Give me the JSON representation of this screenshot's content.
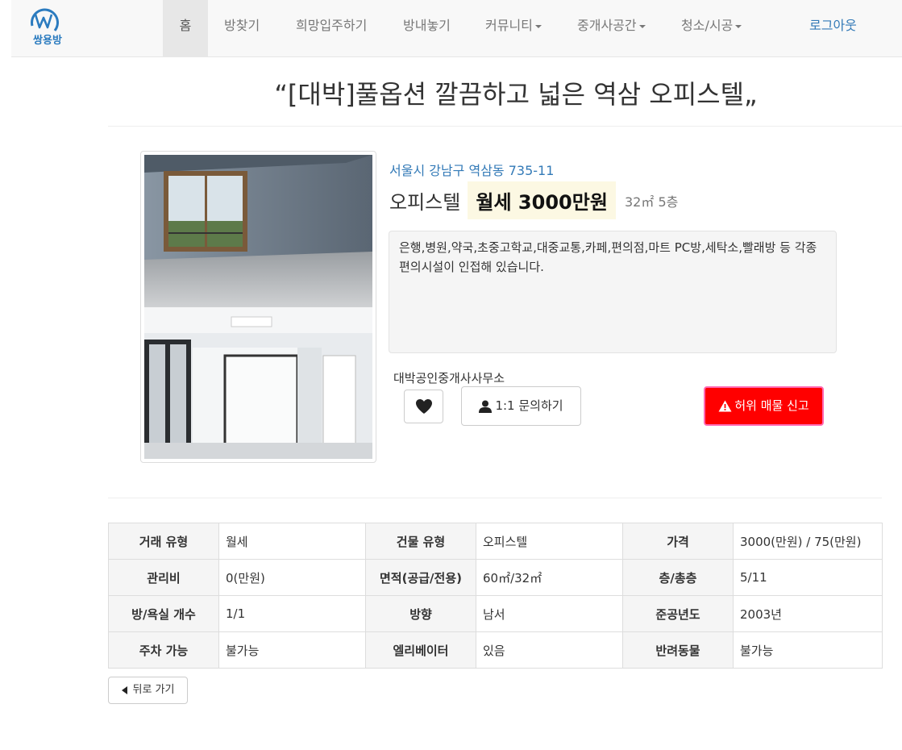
{
  "nav": {
    "logo_text": "쌍용방",
    "items": [
      {
        "label": "홈"
      },
      {
        "label": "방찾기"
      },
      {
        "label": "희망입주하기"
      },
      {
        "label": "방내놓기"
      },
      {
        "label": "커뮤니티"
      },
      {
        "label": "중개사공간"
      },
      {
        "label": "청소/시공"
      }
    ],
    "logout_label": "로그아웃"
  },
  "listing": {
    "title": "“[대박]풀옵션 깔끔하고 넓은 역삼 오피스텔„",
    "address": "서울시 강남구 역삼동 735-11",
    "building_type": "오피스텔",
    "price_label": "월세 3000만원",
    "size_floor": "32㎡ 5층",
    "description": "은행,병원,약국,초중고학교,대중교통,카페,편의점,마트 PC방,세탁소,빨래방 등 각종 편의시설이 인접해 있습니다.",
    "agency": "대박공인중개사사무소",
    "inquiry_label": "1:1 문의하기",
    "report_label": "허위 매물 신고",
    "heart_icon": "heart-icon",
    "user_icon": "user-icon",
    "warning_icon": "warning-icon"
  },
  "details": {
    "rows": [
      [
        {
          "label": "거래 유형",
          "value": "월세"
        },
        {
          "label": "건물 유형",
          "value": "오피스텔"
        },
        {
          "label": "가격",
          "value": "3000(만원) / 75(만원)"
        }
      ],
      [
        {
          "label": "관리비",
          "value": "0(만원)"
        },
        {
          "label": "면적(공급/전용)",
          "value": "60㎡/32㎡"
        },
        {
          "label": "층/총층",
          "value": "5/11"
        }
      ],
      [
        {
          "label": "방/욕실 개수",
          "value": "1/1"
        },
        {
          "label": "방향",
          "value": "남서"
        },
        {
          "label": "준공년도",
          "value": "2003년"
        }
      ],
      [
        {
          "label": "주차 가능",
          "value": "불가능"
        },
        {
          "label": "엘리베이터",
          "value": "있음"
        },
        {
          "label": "반려동물",
          "value": "불가능"
        }
      ]
    ]
  },
  "back_label": "뒤로 가기",
  "colors": {
    "link": "#337ab7",
    "price_bg": "#fcf8e3",
    "report_bg": "#ff0000",
    "report_border": "#ff69b4"
  }
}
